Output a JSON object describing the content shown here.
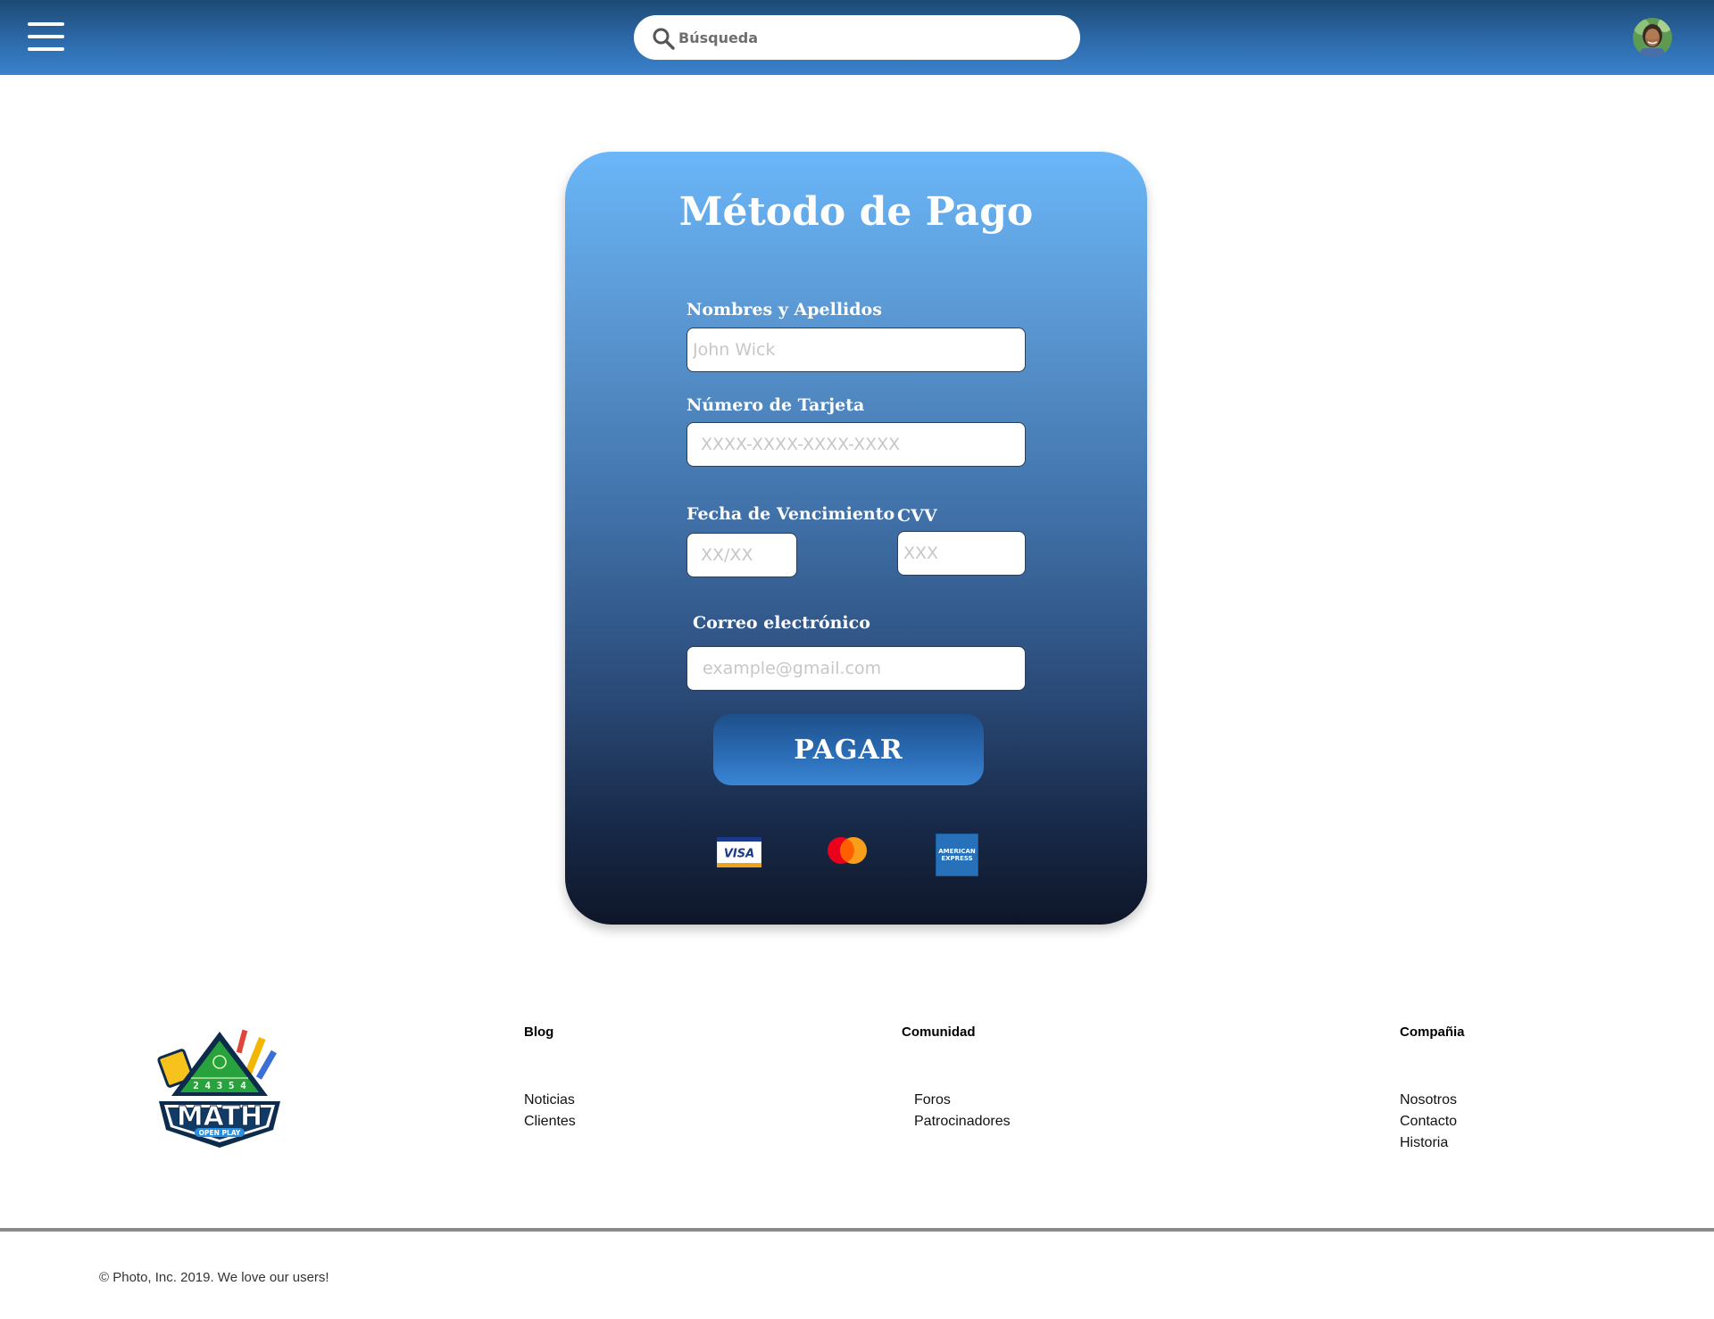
{
  "header": {
    "search_placeholder": "Búsqueda"
  },
  "payment": {
    "title": "Método de Pago",
    "name_label": "Nombres y Apellidos",
    "name_placeholder": "John Wick",
    "card_number_label": "Número de Tarjeta",
    "card_number_placeholder": "XXXX-XXXX-XXXX-XXXX",
    "expiry_label": "Fecha de Vencimiento",
    "expiry_placeholder": "XX/XX",
    "cvv_label": "CVV",
    "cvv_placeholder": "XXX",
    "email_label": "Correo electrónico",
    "email_placeholder": "example@gmail.com",
    "pay_button": "PAGAR",
    "card_brands": {
      "visa": "VISA",
      "mastercard": "mastercard",
      "amex": [
        "AMERICAN",
        "EXPRESS"
      ]
    }
  },
  "footer": {
    "logo": {
      "word": "MATH",
      "tagline": "OPEN PLAY",
      "numbers": "2 4 3 5 4"
    },
    "columns": [
      {
        "heading": "Blog",
        "links": [
          "Noticias",
          "Clientes"
        ]
      },
      {
        "heading": "Comunidad",
        "links": [
          "Foros",
          "Patrocinadores"
        ]
      },
      {
        "heading": "Compañia",
        "links": [
          "Nosotros",
          "Contacto",
          "Historia"
        ]
      }
    ],
    "copyright": "© Photo, Inc. 2019. We love our users!"
  },
  "colors": {
    "header_blue": "#2d6aab",
    "card_top": "#6ab6f8",
    "card_bottom": "#0e1628",
    "button_blue": "#2a6bb4"
  }
}
